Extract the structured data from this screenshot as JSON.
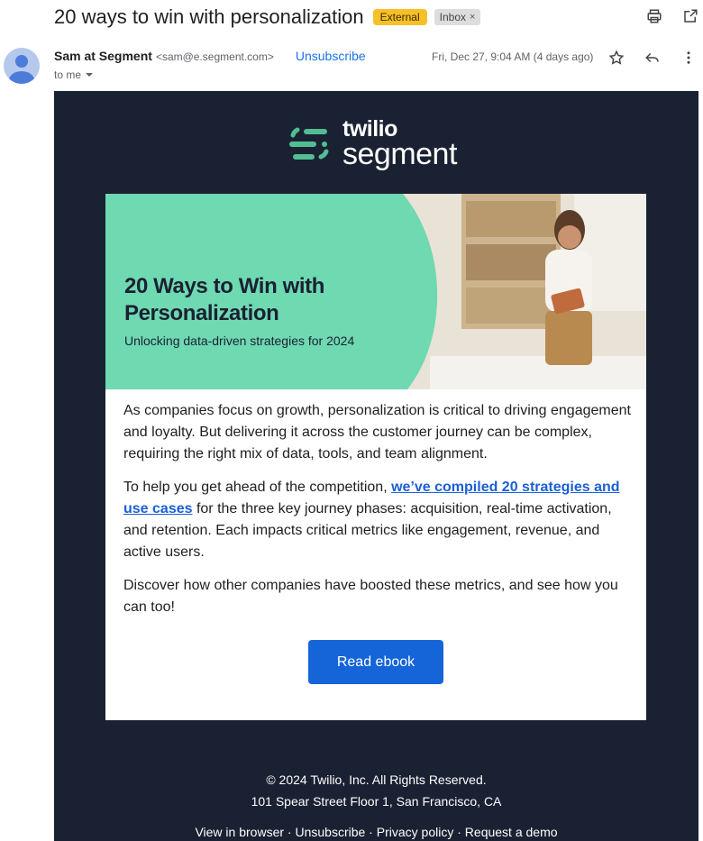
{
  "header": {
    "subject": "20 ways to win with personalization",
    "external_label": "External",
    "inbox_label": "Inbox",
    "inbox_close": "×"
  },
  "sender": {
    "name": "Sam at Segment",
    "email": "<sam@e.segment.com>",
    "unsubscribe": "Unsubscribe",
    "to": "to me",
    "date": "Fri, Dec 27, 9:04 AM (4 days ago)"
  },
  "logo": {
    "line1": "twilio",
    "line2": "segment"
  },
  "hero": {
    "title": "20 Ways to Win with Personalization",
    "subtitle": "Unlocking data-driven strategies for 2024"
  },
  "body": {
    "p1": "As companies focus on growth, personalization is critical to driving engagement and loyalty. But delivering it across the customer journey can be complex, requiring the right mix of data, tools, and team alignment.",
    "p2_before": "To help you get ahead of the competition, ",
    "p2_link": "we’ve compiled 20 strategies and use cases",
    "p2_after": " for the three key journey phases: acquisition, real-time activation, and retention. Each impacts critical metrics like engagement, revenue, and active users.",
    "p3": "Discover how other companies have boosted these metrics, and see how you can too!",
    "cta": "Read ebook"
  },
  "footer": {
    "copyright": "© 2024 Twilio, Inc. All Rights Reserved.",
    "address": "101 Spear Street Floor 1, San Francisco, CA",
    "links": [
      "View in browser",
      "Unsubscribe",
      "Privacy policy",
      "Request a demo"
    ],
    "separator": " · "
  },
  "colors": {
    "accent_blue": "#1a73e8",
    "email_bg": "#1a2132",
    "hero_green": "#6fd9b1",
    "button_blue": "#1565d8",
    "external_badge": "#f6c026"
  },
  "icons": [
    "print-icon",
    "open-new-window-icon",
    "star-icon",
    "reply-icon",
    "more-vert-icon",
    "chevron-down-icon",
    "avatar-person-icon"
  ]
}
